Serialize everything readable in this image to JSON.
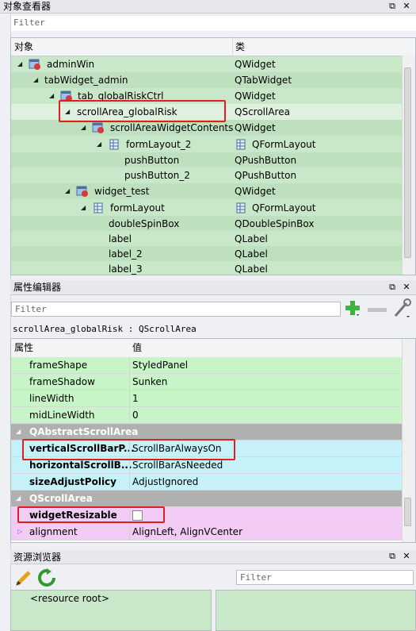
{
  "object_inspector": {
    "title": "对象查看器",
    "filter_placeholder": "Filter",
    "col_object": "对象",
    "col_class": "类",
    "rows": [
      {
        "name": "adminWin",
        "cls": "QWidget"
      },
      {
        "name": "tabWidget_admin",
        "cls": "QTabWidget"
      },
      {
        "name": "tab_globalRiskCtrl",
        "cls": "QWidget"
      },
      {
        "name": "scrollArea_globalRisk",
        "cls": "QScrollArea"
      },
      {
        "name": "scrollAreaWidgetContents",
        "cls": "QWidget"
      },
      {
        "name": "formLayout_2",
        "cls": "QFormLayout"
      },
      {
        "name": "pushButton",
        "cls": "QPushButton"
      },
      {
        "name": "pushButton_2",
        "cls": "QPushButton"
      },
      {
        "name": "widget_test",
        "cls": "QWidget"
      },
      {
        "name": "formLayout",
        "cls": "QFormLayout"
      },
      {
        "name": "doubleSpinBox",
        "cls": "QDoubleSpinBox"
      },
      {
        "name": "label",
        "cls": "QLabel"
      },
      {
        "name": "label_2",
        "cls": "QLabel"
      },
      {
        "name": "label_3",
        "cls": "QLabel"
      }
    ]
  },
  "property_editor": {
    "title": "属性编辑器",
    "filter_placeholder": "Filter",
    "context": "scrollArea_globalRisk : QScrollArea",
    "col_prop": "属性",
    "col_value": "值",
    "rows": [
      {
        "k": "frameShape",
        "v": "StyledPanel"
      },
      {
        "k": "frameShadow",
        "v": "Sunken"
      },
      {
        "k": "lineWidth",
        "v": "1"
      },
      {
        "k": "midLineWidth",
        "v": "0"
      },
      {
        "k": "QAbstractScrollArea",
        "v": ""
      },
      {
        "k": "verticalScrollBarP...",
        "v": "ScrollBarAlwaysOn"
      },
      {
        "k": "horizontalScrollB...",
        "v": "ScrollBarAsNeeded"
      },
      {
        "k": "sizeAdjustPolicy",
        "v": "AdjustIgnored"
      },
      {
        "k": "QScrollArea",
        "v": ""
      },
      {
        "k": "widgetResizable",
        "v": ""
      },
      {
        "k": "alignment",
        "v": "AlignLeft, AlignVCenter"
      }
    ]
  },
  "resource_browser": {
    "title": "资源浏览器",
    "filter_placeholder": "Filter",
    "root_label": "<resource root>"
  },
  "title_buttons": {
    "float": "⧉",
    "close": "✕"
  },
  "colors": {
    "accent_red": "#e02020",
    "tree_green": "#c9e7c9",
    "prop_green": "#c7f5c7"
  }
}
